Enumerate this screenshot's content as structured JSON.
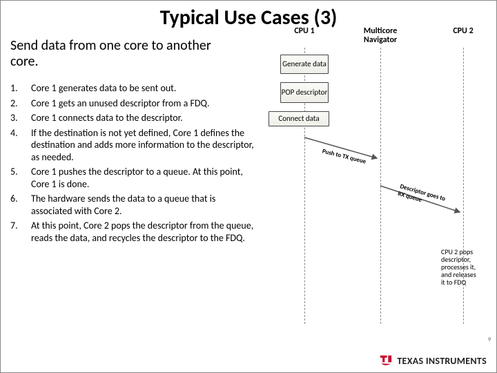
{
  "title": "Typical Use Cases (3)",
  "subtitle": "Send data from one core to another core.",
  "steps": [
    {
      "n": "1.",
      "t": "Core 1 generates data to be sent out."
    },
    {
      "n": "2.",
      "t": "Core 1 gets an unused descriptor from a FDQ."
    },
    {
      "n": "3.",
      "t": "Core 1 connects data to the descriptor."
    },
    {
      "n": "4.",
      "t": "If the destination is not yet defined, Core 1 defines the destination and adds more information to the descriptor, as needed."
    },
    {
      "n": "5.",
      "t": "Core 1 pushes the descriptor to a queue. At this point, Core 1 is done."
    },
    {
      "n": "6.",
      "t": "The hardware sends the data to a queue that is associated with Core 2."
    },
    {
      "n": "7.",
      "t": "At this point, Core 2 pops the descriptor from the queue, reads the data, and recycles the descriptor to the FDQ."
    }
  ],
  "diagram": {
    "cols": {
      "0": "CPU 1",
      "1a": "Multicore",
      "1b": "Navigator",
      "2": "CPU 2"
    },
    "boxes": {
      "0": "Generate data",
      "1": "POP descriptor",
      "2": "Connect data"
    },
    "arrows": {
      "0": "Push to TX queue",
      "1a": "Descriptor goes to",
      "1b": "RX queue"
    },
    "cpu2": {
      "0": "CPU 2 pops",
      "1": "descriptor,",
      "2": "processes it,",
      "3": "and releases",
      "4": "it to FDQ"
    }
  },
  "brand": "TEXAS INSTRUMENTS",
  "page_no": "9"
}
